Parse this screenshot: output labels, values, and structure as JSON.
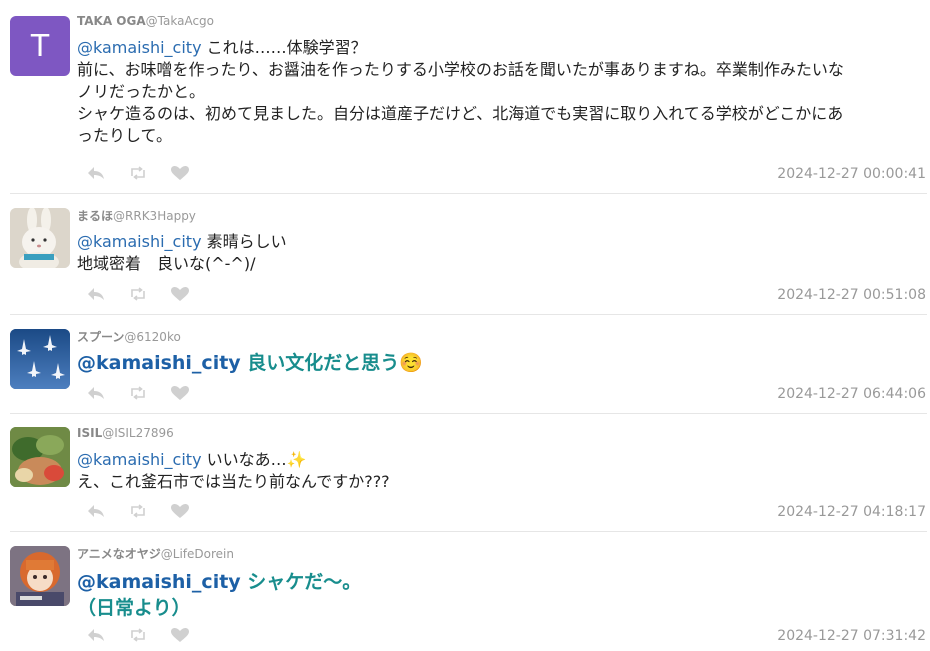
{
  "posts": [
    {
      "name": "TAKA OGA",
      "handle": "@TakaAcgo",
      "avatar_letter": "T",
      "avatar_color": "#7e57c2",
      "mention": "@kamaishi_city",
      "text1": " これは……体験学習？",
      "text2": "前に、お味噌を作ったり、お醤油を作ったりする小学校のお話を聞いたが事ありますね。卒業制作みたいな",
      "text3": "ノリだったかと。",
      "text4": "シャケ造るのは、初めて見ました。自分は道産子だけど、北海道でも実習に取り入れてる学校がどこかにあ",
      "text5": "ったりして。",
      "timestamp": "2024-12-27 00:00:41"
    },
    {
      "name": "まるほ",
      "handle": "@RRK3Happy",
      "mention": "@kamaishi_city",
      "text1": " 素晴らしい",
      "text2": "地域密着　良いな(^-^)/",
      "timestamp": "2024-12-27 00:51:08"
    },
    {
      "name": "スプーン",
      "handle": "@6120ko",
      "mention": "@kamaishi_city",
      "text1": " 良い文化だと思う☺️",
      "timestamp": "2024-12-27 06:44:06"
    },
    {
      "name": "ISIL",
      "handle": "@ISIL27896",
      "mention": "@kamaishi_city",
      "text1": " いいなあ…✨",
      "text2": "え、これ釜石市では当たり前なんですか???",
      "timestamp": "2024-12-27 04:18:17"
    },
    {
      "name": "アニメなオヤジ",
      "handle": "@LifeDorein",
      "mention": "@kamaishi_city",
      "text1": " シャケだ〜。",
      "text2": "（日常より）",
      "timestamp": "2024-12-27 07:31:42"
    }
  ],
  "icons": {
    "reply": "reply-icon",
    "retweet": "retweet-icon",
    "like": "heart-icon"
  },
  "colors": {
    "mention": "#2b6cb0",
    "big_text": "#188d8d",
    "icon": "#d0d0d0",
    "timestamp": "#999999"
  }
}
